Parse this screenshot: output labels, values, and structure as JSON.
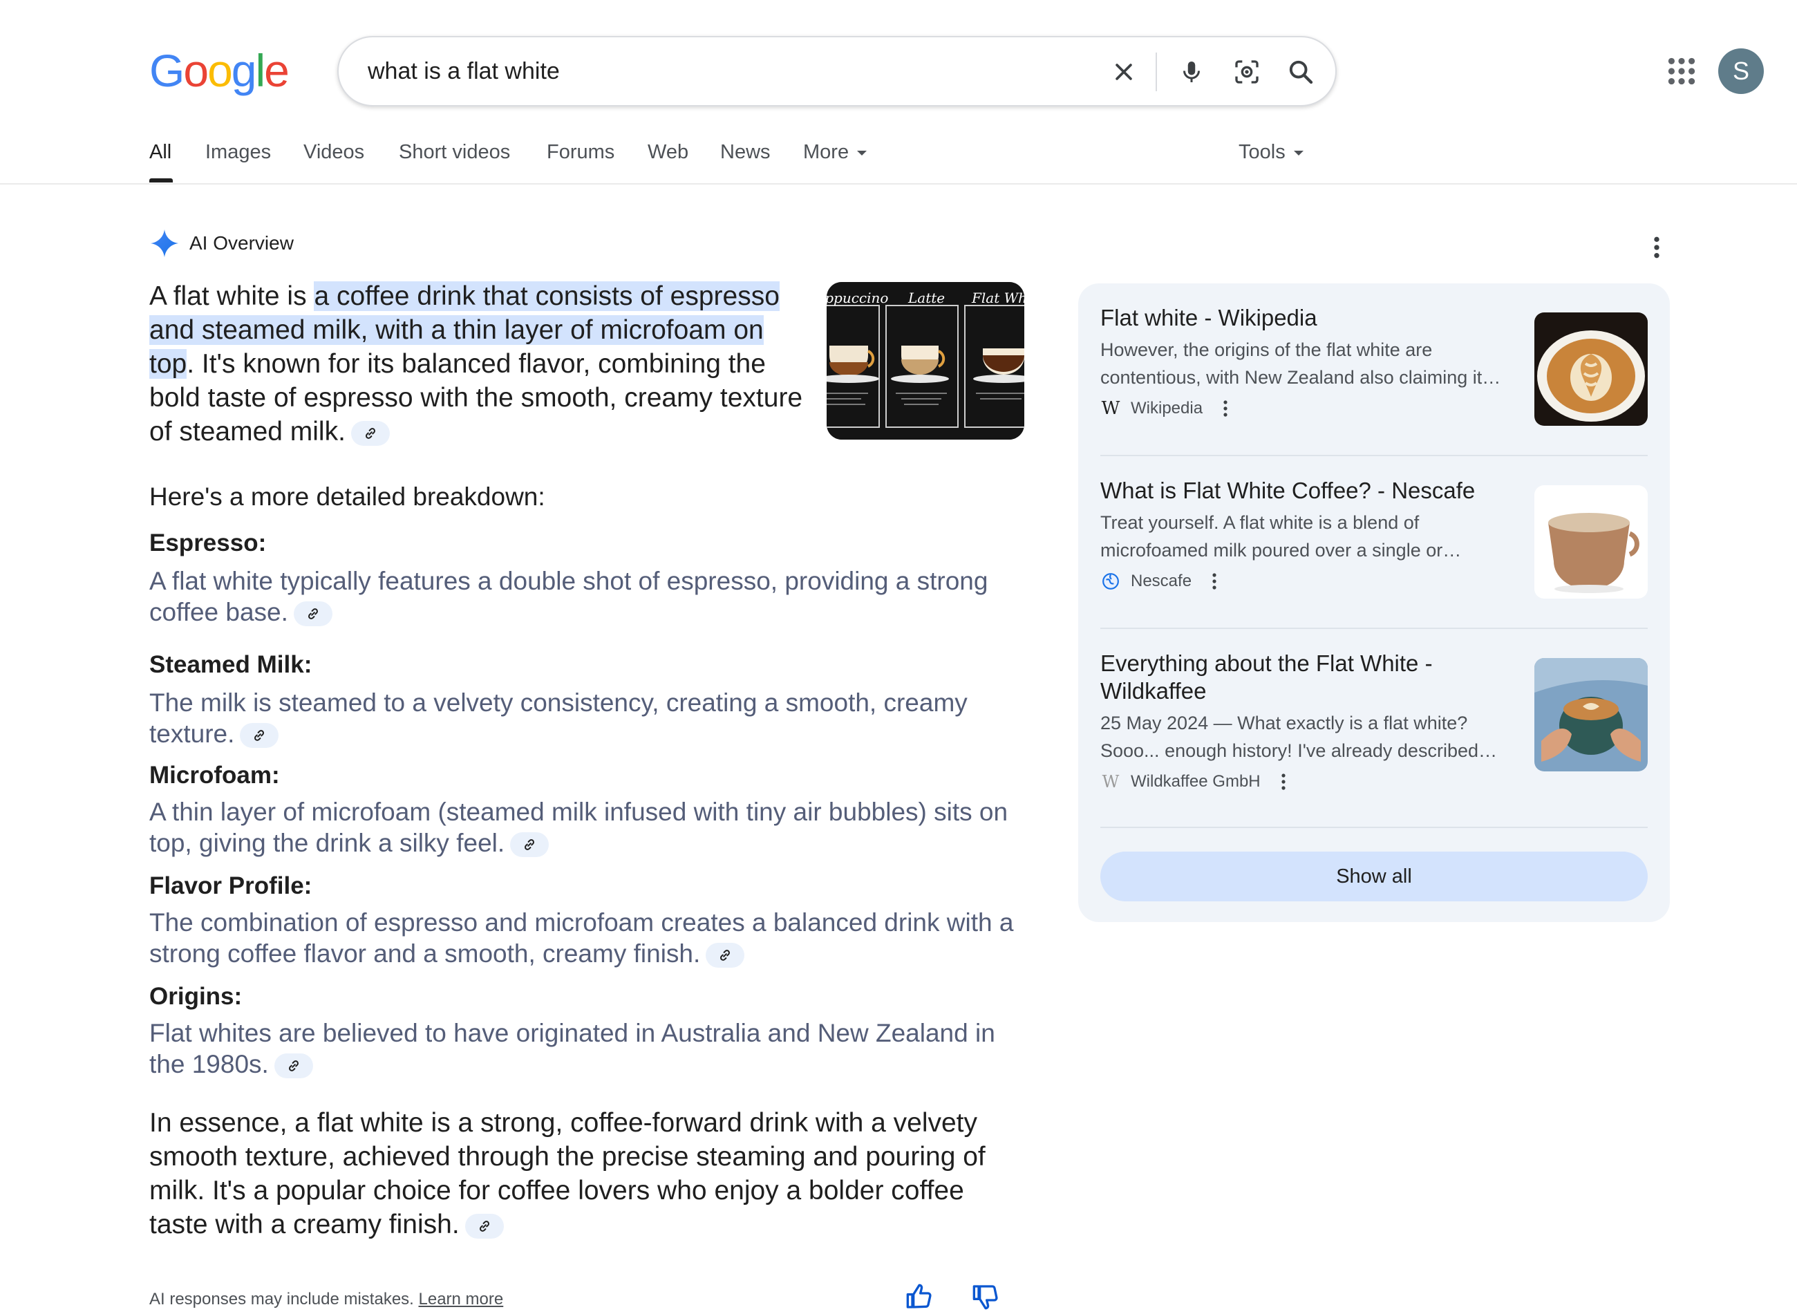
{
  "header": {
    "logo": "Google",
    "query": "what is a flat white",
    "avatar_initial": "S"
  },
  "tabs": [
    {
      "label": "All",
      "active": true
    },
    {
      "label": "Images"
    },
    {
      "label": "Videos"
    },
    {
      "label": "Short videos"
    },
    {
      "label": "Forums"
    },
    {
      "label": "Web"
    },
    {
      "label": "News"
    },
    {
      "label": "More"
    }
  ],
  "tools_label": "Tools",
  "ai_overview": {
    "title": "AI Overview",
    "intro_prefix": "A flat white is ",
    "intro_highlight": "a coffee drink that consists of espresso and steamed milk, with a thin layer of microfoam on top",
    "intro_suffix": ". It's known for its balanced flavor, combining the bold taste of espresso with the smooth, creamy texture of steamed milk.",
    "image_labels": [
      "Cappuccino",
      "Latte",
      "Flat White"
    ],
    "breakdown_heading": "Here's a more detailed breakdown:",
    "items": [
      {
        "heading": "Espresso:",
        "body": "A flat white typically features a double shot of espresso, providing a strong coffee base."
      },
      {
        "heading": "Steamed Milk:",
        "body": "The milk is steamed to a velvety consistency, creating a smooth, creamy texture."
      },
      {
        "heading": "Microfoam:",
        "body": "A thin layer of microfoam (steamed milk infused with tiny air bubbles) sits on top, giving the drink a silky feel."
      },
      {
        "heading": "Flavor Profile:",
        "body": "The combination of espresso and microfoam creates a balanced drink with a strong coffee flavor and a smooth, creamy finish."
      },
      {
        "heading": "Origins:",
        "body": "Flat whites are believed to have originated in Australia and New Zealand in the 1980s."
      }
    ],
    "essence": "In essence, a flat white is a strong, coffee-forward drink with a velvety smooth texture, achieved through the precise steaming and pouring of milk. It's a popular choice for coffee lovers who enjoy a bolder coffee taste with a creamy finish.",
    "disclaimer": "AI responses may include mistakes.",
    "learn_more": "Learn more"
  },
  "sources": [
    {
      "title": "Flat white - Wikipedia",
      "snippet": "However, the origins of the flat white are contentious, with New Zealand also claiming it…",
      "site": "Wikipedia"
    },
    {
      "title": "What is Flat White Coffee? - Nescafe",
      "snippet": "Treat yourself. A flat white is a blend of microfoamed milk poured over a single or…",
      "site": "Nescafe"
    },
    {
      "title": "Everything about the Flat White - Wildkaffee",
      "snippet": "25 May 2024 — What exactly is a flat white? Sooo... enough history! I've already described…",
      "site": "Wildkaffee GmbH"
    }
  ],
  "show_all": "Show all",
  "colors": {
    "accent": "#0b57d0",
    "highlight": "#d3e3fd",
    "panel": "#f0f4f9"
  }
}
